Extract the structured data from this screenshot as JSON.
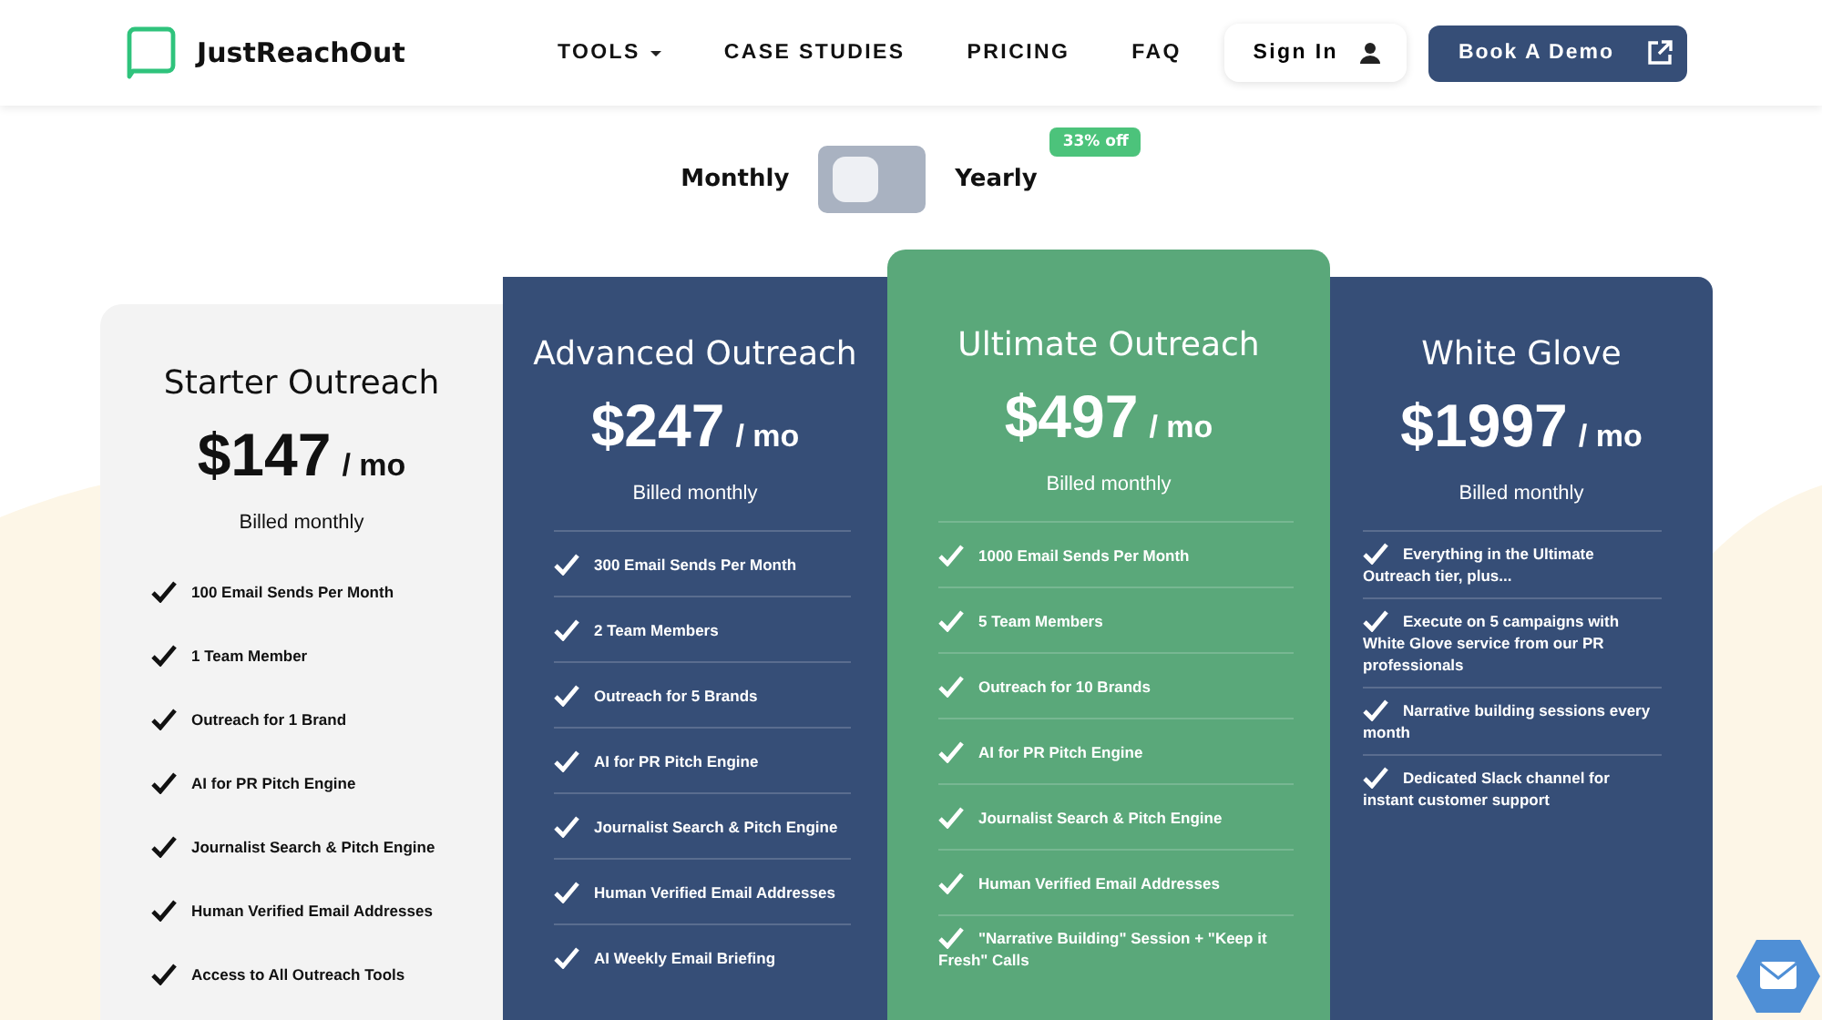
{
  "header": {
    "brand": "JustReachOut",
    "nav": [
      {
        "label": "TOOLS",
        "dropdown": true
      },
      {
        "label": "CASE STUDIES",
        "dropdown": false
      },
      {
        "label": "PRICING",
        "dropdown": false
      },
      {
        "label": "FAQ",
        "dropdown": false
      }
    ],
    "sign_in": "Sign In",
    "demo": "Book A Demo"
  },
  "billing": {
    "left_label": "Monthly",
    "right_label": "Yearly",
    "yearly": false,
    "badge": "33% off"
  },
  "plans": [
    {
      "kind": "light",
      "name": "Starter Outreach",
      "price": "$147",
      "unit": "/ mo",
      "billed": "Billed monthly",
      "features": [
        "100 Email Sends Per Month",
        "1 Team Member",
        "Outreach for 1 Brand",
        "AI for PR Pitch Engine",
        "Journalist Search & Pitch Engine",
        "Human Verified Email Addresses",
        "Access to All Outreach Tools"
      ]
    },
    {
      "kind": "dark",
      "name": "Advanced Outreach",
      "price": "$247",
      "unit": "/ mo",
      "billed": "Billed monthly",
      "features": [
        "300 Email Sends Per Month",
        "2 Team Members",
        "Outreach for 5 Brands",
        "AI for PR Pitch Engine",
        "Journalist Search & Pitch Engine",
        "Human Verified Email Addresses",
        "AI Weekly Email Briefing"
      ]
    },
    {
      "kind": "green",
      "name": "Ultimate Outreach",
      "price": "$497",
      "unit": "/ mo",
      "billed": "Billed monthly",
      "features": [
        "1000 Email Sends Per Month",
        "5 Team Members",
        "Outreach for 10 Brands",
        "AI for PR Pitch Engine",
        "Journalist Search & Pitch Engine",
        "Human Verified Email Addresses",
        "\"Narrative Building\" Session + \"Keep it Fresh\" Calls"
      ]
    },
    {
      "kind": "dark",
      "name": "White Glove",
      "price": "$1997",
      "unit": "/ mo",
      "billed": "Billed monthly",
      "features": [
        "Everything in the Ultimate Outreach tier, plus...",
        "Execute on 5 campaigns with White Glove service from our PR professionals",
        "Narrative building sessions every month",
        "Dedicated Slack channel for instant customer support"
      ]
    }
  ]
}
